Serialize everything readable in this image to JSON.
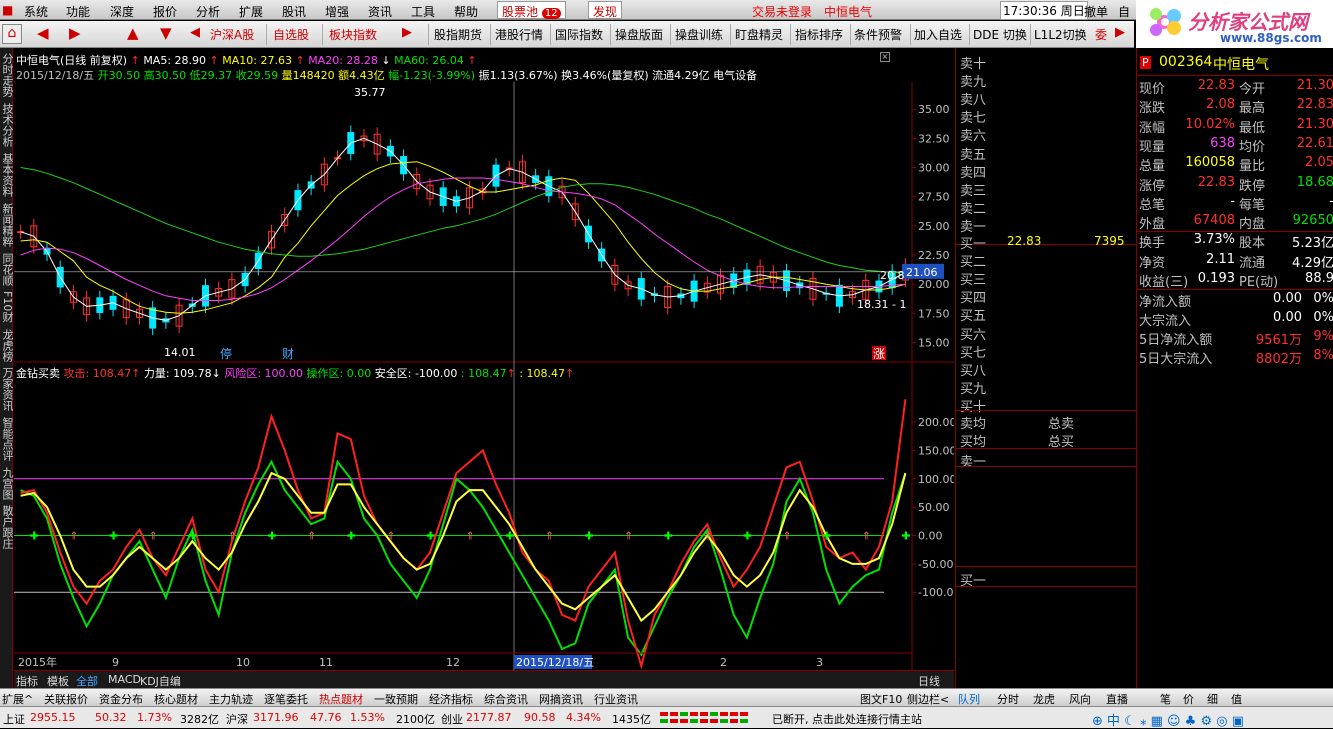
{
  "menu": {
    "items": [
      "系统",
      "功能",
      "深度",
      "报价",
      "分析",
      "扩展",
      "股讯",
      "增强",
      "资讯",
      "工具",
      "帮助"
    ],
    "pool": "股票池",
    "pool_badge": "12",
    "discover": "发现",
    "login": "交易未登录",
    "stock_name_top": "中恒电气",
    "time": "17:30:36",
    "weekday": "周日",
    "undo": "撤单",
    "self": "自"
  },
  "toolbar": {
    "buttons": [
      "沪深A股",
      "自选股",
      "板块指数",
      "股指期货",
      "港股行情",
      "国际指数",
      "操盘版面",
      "操盘训练",
      "盯盘精灵",
      "指标排序",
      "条件预警",
      "加入自选",
      "DDE 切换",
      "L1L2切换",
      "委"
    ]
  },
  "leftnav": [
    "分时走势",
    "技术分析",
    "基本资料",
    "新闻精粹",
    "同花顺",
    "F10财",
    "龙虎榜",
    "万家资讯",
    "智能点评",
    "九宫图",
    "散户跟庄"
  ],
  "chart_header": {
    "title": "中恒电气(日线 前复权)",
    "ma5": "MA5: 28.90",
    "ma10": "MA10: 27.63",
    "ma20": "MA20: 28.28",
    "ma60": "MA60: 26.04",
    "info_date": "2015/12/18/五",
    "info_open": "开30.50",
    "info_high": "高30.50",
    "info_low": "低29.37",
    "info_close": "收29.59",
    "info_vol": "量148420",
    "info_amt": "额4.43亿",
    "info_chg": "幅-1.23(-3.99%)",
    "info_rest": "振1.13(3.67%) 换3.46%(量复权) 流通4.29亿 电气设备"
  },
  "chart_data": {
    "type": "line",
    "title": "中恒电气(日线 前复权)",
    "y_ticks": [
      "35.00",
      "32.50",
      "30.00",
      "27.50",
      "25.00",
      "22.50",
      "20.00",
      "17.50",
      "15.00"
    ],
    "ylim": [
      13.5,
      37.5
    ],
    "x_labels": [
      "2015年",
      "9",
      "10",
      "11",
      "12",
      "2015/12/18/五",
      "2",
      "3"
    ],
    "annotations": [
      "35.77",
      "14.01",
      "18.31",
      "20.8",
      "21.06"
    ],
    "flags": [
      "停",
      "财",
      "涨"
    ],
    "last_label": "21.06",
    "period": "日线",
    "series": [
      {
        "name": "MA5",
        "color": "#ffffff",
        "values": [
          24.5,
          24.1,
          22.8,
          20.6,
          18.9,
          18.1,
          18.2,
          18.4,
          17.9,
          17.5,
          17.1,
          16.9,
          17.3,
          18.2,
          19.0,
          19.3,
          19.6,
          20.4,
          22.0,
          23.8,
          25.5,
          27.2,
          28.5,
          29.4,
          30.8,
          32.1,
          32.5,
          32.0,
          31.4,
          30.2,
          28.8,
          27.9,
          27.5,
          27.1,
          27.4,
          28.0,
          29.3,
          29.9,
          29.6,
          29.0,
          28.4,
          27.9,
          26.2,
          24.3,
          22.5,
          20.8,
          19.9,
          19.6,
          19.1,
          18.9,
          19.0,
          19.4,
          19.7,
          20.0,
          20.3,
          20.6,
          20.8,
          20.6,
          20.3,
          19.9,
          19.6,
          19.2,
          19.0,
          19.1,
          19.5,
          19.8,
          20.4,
          21.0
        ]
      },
      {
        "name": "MA10",
        "color": "#ffff00",
        "values": [
          23.7,
          23.8,
          23.6,
          22.8,
          22.0,
          20.6,
          19.9,
          19.4,
          18.7,
          18.1,
          17.8,
          17.6,
          17.5,
          17.6,
          17.8,
          18.1,
          18.4,
          19.0,
          19.7,
          20.6,
          22.3,
          23.5,
          25.0,
          26.3,
          27.6,
          28.5,
          29.3,
          29.9,
          30.3,
          30.4,
          30.5,
          30.1,
          29.6,
          29.0,
          28.4,
          27.9,
          27.9,
          28.1,
          28.3,
          28.5,
          28.9,
          29.1,
          28.9,
          27.8,
          26.5,
          25.2,
          23.6,
          22.2,
          21.0,
          20.1,
          19.6,
          19.4,
          19.4,
          19.6,
          19.8,
          20.1,
          20.4,
          20.6,
          20.6,
          20.4,
          20.2,
          20.0,
          19.8,
          19.6,
          19.5,
          19.5,
          19.7,
          20.0
        ]
      },
      {
        "name": "MA20",
        "color": "#ff40ff",
        "values": [
          22.5,
          22.9,
          23.1,
          23.0,
          22.7,
          22.2,
          21.6,
          21.0,
          20.4,
          19.9,
          19.4,
          19.0,
          18.8,
          18.6,
          18.6,
          18.6,
          18.7,
          18.9,
          19.2,
          19.7,
          20.4,
          21.2,
          22.0,
          22.9,
          23.8,
          24.8,
          25.8,
          26.7,
          27.5,
          28.1,
          28.6,
          28.8,
          29.0,
          29.1,
          29.1,
          29.1,
          29.0,
          28.8,
          28.6,
          28.3,
          28.0,
          27.9,
          27.8,
          27.6,
          27.3,
          26.8,
          26.0,
          25.2,
          24.3,
          23.5,
          22.7,
          21.9,
          21.2,
          20.7,
          20.3,
          20.0,
          19.8,
          19.7,
          19.7,
          19.8,
          19.8,
          19.8,
          19.8,
          19.8,
          19.8,
          19.8,
          19.9,
          20.0
        ]
      },
      {
        "name": "MA60",
        "color": "#20d020",
        "values": [
          30.0,
          29.8,
          29.5,
          29.1,
          28.7,
          28.2,
          27.7,
          27.2,
          26.7,
          26.2,
          25.7,
          25.2,
          24.8,
          24.4,
          24.0,
          23.6,
          23.3,
          23.0,
          22.8,
          22.6,
          22.5,
          22.4,
          22.4,
          22.5,
          22.6,
          22.8,
          23.0,
          23.3,
          23.6,
          23.9,
          24.2,
          24.5,
          24.8,
          25.0,
          25.3,
          25.6,
          26.0,
          26.5,
          27.0,
          27.5,
          27.9,
          28.3,
          28.5,
          28.6,
          28.6,
          28.5,
          28.3,
          28.0,
          27.7,
          27.3,
          26.9,
          26.5,
          26.0,
          25.6,
          25.1,
          24.6,
          24.1,
          23.6,
          23.1,
          22.7,
          22.3,
          21.9,
          21.6,
          21.4,
          21.2,
          21.1,
          21.0,
          21.0
        ]
      }
    ],
    "indicator": {
      "name": "金钻买卖",
      "labels": [
        "攻击: 108.47",
        "力量: 109.78",
        "风险区: 100.00",
        "操作区: 0.00",
        "安全区: -100.00",
        ": 108.47",
        ": 108.47"
      ],
      "y_ticks": [
        "200.00",
        "150.00",
        "100.00",
        "50.00",
        "0.00",
        "-50.00",
        "-100.00"
      ],
      "ylim": [
        -230,
        260
      ],
      "levels": [
        100,
        0,
        -100
      ],
      "attack": [
        75,
        80,
        40,
        -30,
        -90,
        -120,
        -80,
        -60,
        -20,
        10,
        -40,
        -70,
        -20,
        30,
        -60,
        -100,
        -10,
        60,
        120,
        210,
        150,
        80,
        30,
        40,
        180,
        170,
        70,
        20,
        -10,
        -40,
        -60,
        -30,
        40,
        110,
        130,
        150,
        90,
        40,
        -30,
        -60,
        -80,
        -140,
        -150,
        -90,
        -60,
        -30,
        -150,
        -230,
        -140,
        -100,
        -50,
        -10,
        20,
        -40,
        -90,
        -60,
        -20,
        50,
        120,
        130,
        60,
        -20,
        -40,
        -30,
        -60,
        -20,
        60,
        240
      ],
      "power": [
        80,
        70,
        30,
        -50,
        -110,
        -160,
        -120,
        -70,
        -40,
        -10,
        -60,
        -110,
        -40,
        10,
        -80,
        -140,
        -30,
        40,
        90,
        130,
        80,
        50,
        20,
        30,
        130,
        100,
        30,
        0,
        -50,
        -80,
        -110,
        -60,
        20,
        100,
        80,
        50,
        10,
        -30,
        -70,
        -110,
        -150,
        -200,
        -190,
        -120,
        -90,
        -60,
        -180,
        -210,
        -160,
        -110,
        -70,
        -20,
        10,
        -60,
        -140,
        -180,
        -110,
        -50,
        60,
        100,
        40,
        -60,
        -120,
        -90,
        -70,
        -60,
        40,
        110
      ],
      "line3": [
        70,
        75,
        50,
        0,
        -60,
        -90,
        -90,
        -70,
        -40,
        -20,
        -40,
        -60,
        -40,
        -10,
        -40,
        -60,
        -30,
        20,
        60,
        110,
        100,
        70,
        40,
        40,
        90,
        90,
        50,
        20,
        -10,
        -40,
        -60,
        -50,
        0,
        60,
        80,
        80,
        50,
        20,
        -20,
        -60,
        -90,
        -120,
        -130,
        -110,
        -90,
        -70,
        -110,
        -150,
        -130,
        -100,
        -70,
        -30,
        0,
        -30,
        -70,
        -90,
        -70,
        -30,
        40,
        80,
        50,
        0,
        -40,
        -50,
        -50,
        -40,
        20,
        110
      ]
    }
  },
  "orderbook": {
    "sell": [
      "卖十",
      "卖九",
      "卖八",
      "卖七",
      "卖六",
      "卖五",
      "卖四",
      "卖三",
      "卖二",
      "卖一"
    ],
    "buy": [
      "买一",
      "买二",
      "买三",
      "买四",
      "买五",
      "买六",
      "买七",
      "买八",
      "买九",
      "买十"
    ],
    "buy1_price": "22.83",
    "buy1_vol": "7395",
    "avg_sell": "卖均",
    "avg_buy": "买均",
    "total_sell": "总卖",
    "total_buy": "总买",
    "sell1b": "卖一",
    "buy1b": "买一"
  },
  "quote": {
    "flag": "P",
    "code": "002364",
    "name": "中恒电气",
    "rows": [
      [
        "现价",
        "22.83",
        "今开",
        "21.30"
      ],
      [
        "涨跌",
        "2.08",
        "最高",
        "22.83"
      ],
      [
        "涨幅",
        "10.02%",
        "最低",
        "21.30"
      ],
      [
        "现量",
        "638",
        "均价",
        "22.61"
      ],
      [
        "总量",
        "160058",
        "量比",
        "2.05"
      ],
      [
        "涨停",
        "22.83",
        "跌停",
        "18.68"
      ],
      [
        "总笔",
        "-",
        "每笔",
        "-"
      ],
      [
        "外盘",
        "67408",
        "内盘",
        "92650"
      ],
      [
        "换手",
        "3.73%",
        "股本",
        "5.23亿"
      ],
      [
        "净资",
        "2.11",
        "流通",
        "4.29亿"
      ],
      [
        "收益(三)",
        "0.193",
        "PE(动)",
        "88.9"
      ]
    ],
    "flows": [
      [
        "净流入额",
        "0.00",
        "0%"
      ],
      [
        "大宗流入",
        "0.00",
        "0%"
      ],
      [
        "5日净流入额",
        "9561万",
        "9%"
      ],
      [
        "5日大宗流入",
        "8802万",
        "8%"
      ]
    ]
  },
  "bottom_tabs": {
    "left": [
      "指标",
      "模板",
      "全部",
      "MACD",
      "KDJ自编"
    ],
    "period": "日线",
    "main": [
      "扩展^",
      "关联报价",
      "资金分布",
      "核心题材",
      "主力轨迹",
      "逐笔委托",
      "热点题材",
      "一致预期",
      "经济指标",
      "综合资讯",
      "网摘资讯",
      "行业资讯"
    ],
    "right": [
      "图文F10",
      "侧边栏<"
    ],
    "quote_tabs": [
      "队列",
      "分时",
      "龙虎",
      "风向",
      "直播",
      "笔",
      "价",
      "细",
      "值"
    ]
  },
  "status": {
    "sh_label": "上证",
    "sh_val": "2955.15",
    "sh_chg": "50.32",
    "sh_pct": "1.73%",
    "sh_amt": "3282亿",
    "sz_label": "沪深",
    "sz_val": "3171.96",
    "sz_chg": "47.76",
    "sz_pct": "1.53%",
    "sz_amt": "2100亿",
    "cy_label": "创业",
    "cy_val": "2177.87",
    "cy_chg": "90.58",
    "cy_pct": "4.34%",
    "cy_amt": "1435亿",
    "conn": "已断开, 点击此处连接行情主站"
  },
  "logo": {
    "text": "分析家公式网",
    "url": "www.88gs.com"
  }
}
